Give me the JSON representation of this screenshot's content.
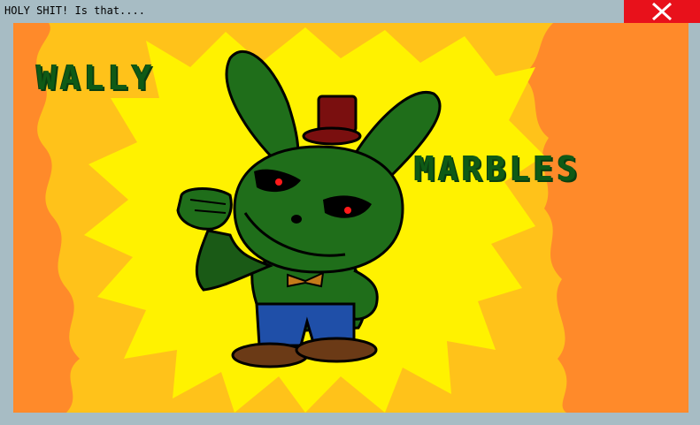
{
  "window": {
    "title": "HOLY SHIT! Is that....",
    "close_icon": "close-icon"
  },
  "scene": {
    "name_first": "WALLY",
    "name_last": "MARBLES"
  },
  "colors": {
    "background_orange": "#ff8a2a",
    "flame_light": "#ffc21a",
    "burst_yellow": "#fff200",
    "character_green": "#1f6e1a",
    "text_green": "#0f5a16",
    "hat_red": "#7a0f0f",
    "pants_blue": "#1f4fa8",
    "shoes_brown": "#6b3a16",
    "eye_red": "#ff1a1a",
    "close_red": "#e8111b"
  }
}
